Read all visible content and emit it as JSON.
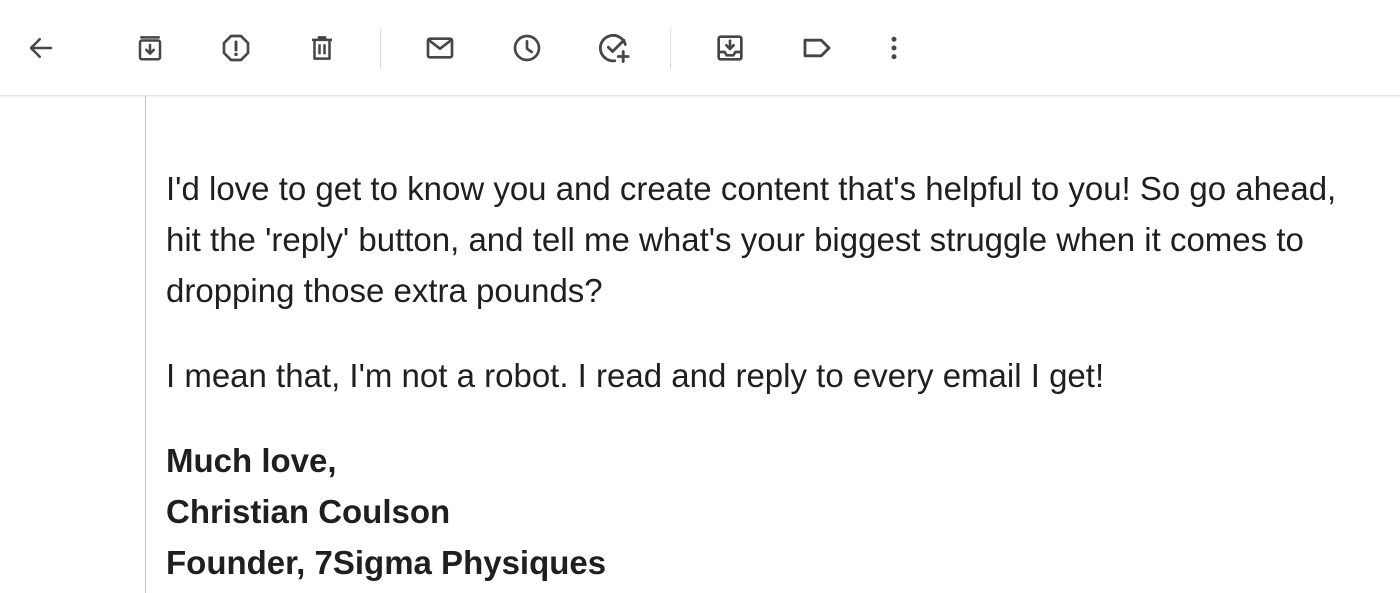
{
  "toolbar": {
    "icons": [
      "back-arrow-icon",
      "archive-icon",
      "report-spam-icon",
      "delete-icon",
      "mark-unread-icon",
      "snooze-icon",
      "add-to-tasks-icon",
      "move-to-icon",
      "label-icon",
      "more-options-icon"
    ]
  },
  "email": {
    "paragraphs": [
      "I'd love to get to know you and create content that's helpful to you! So go ahead, hit the 'reply' button, and tell me what's your biggest struggle when it comes to dropping those extra pounds?",
      "I mean that, I'm not a robot. I read and reply to every email I get!"
    ],
    "signature": {
      "closing": "Much love,",
      "name": "Christian Coulson",
      "title": "Founder, 7Sigma Physiques"
    }
  },
  "colors": {
    "icon": "#444746",
    "text": "#1f1f1f",
    "divider": "#dadce0"
  }
}
